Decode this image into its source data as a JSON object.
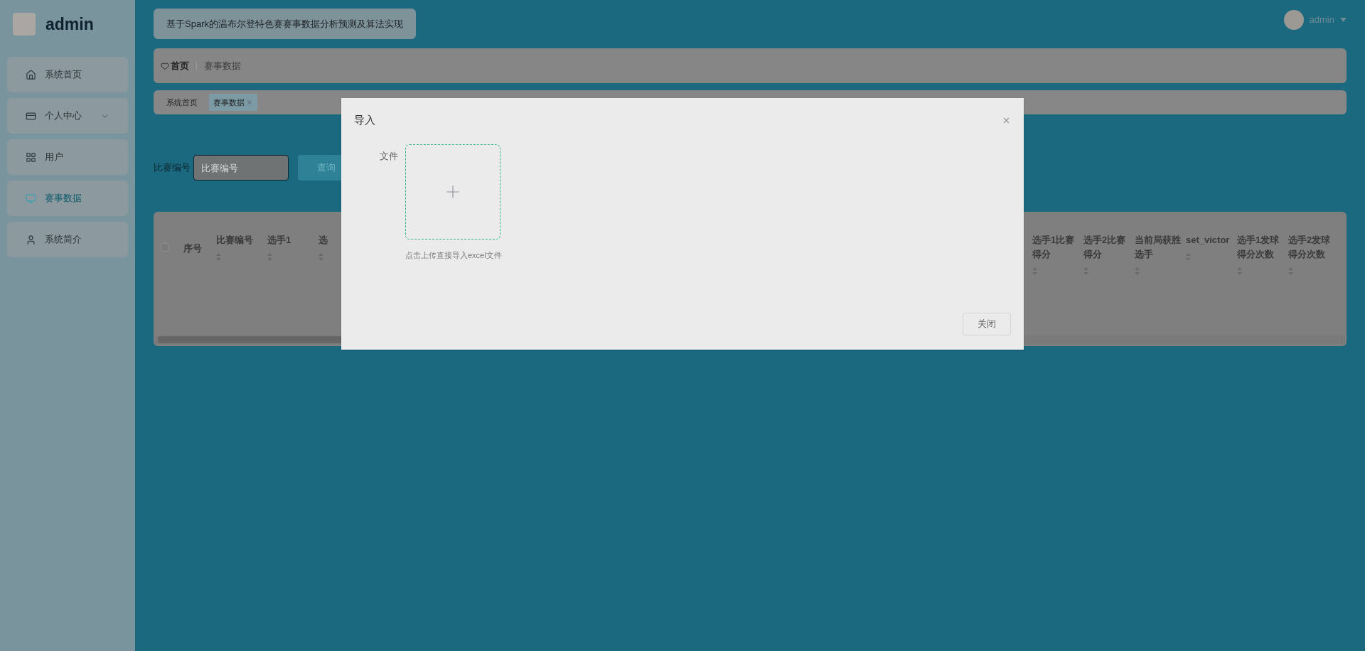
{
  "sidebar": {
    "brand": "admin",
    "items": [
      {
        "label": "系统首页",
        "selected": false,
        "expandable": false
      },
      {
        "label": "个人中心",
        "selected": false,
        "expandable": true
      },
      {
        "label": "用户",
        "selected": false,
        "expandable": false
      },
      {
        "label": "赛事数据",
        "selected": true,
        "expandable": false
      },
      {
        "label": "系统简介",
        "selected": false,
        "expandable": false
      }
    ]
  },
  "header": {
    "title": "基于Spark的温布尔登特色赛赛事数据分析预测及算法实现",
    "user": "admin"
  },
  "breadcrumb": [
    {
      "label": "首页",
      "current": false
    },
    {
      "label": "赛事数据",
      "current": true
    }
  ],
  "tabs": [
    {
      "label": "系统首页",
      "selected": false,
      "closable": false
    },
    {
      "label": "赛事数据",
      "selected": true,
      "closable": true
    }
  ],
  "search": {
    "label": "比赛编号",
    "placeholder": "比赛编号",
    "button": "查询"
  },
  "table": {
    "select_all": {
      "checked": false
    },
    "columns_left_of_dialog": [
      {
        "label": "序号",
        "sortable": false
      },
      {
        "label": "比赛编号",
        "sortable": true
      },
      {
        "label": "选手1",
        "sortable": true
      },
      {
        "label": "选",
        "sortable": true
      }
    ],
    "columns_right_of_dialog": [
      {
        "label": "选手1比赛得分",
        "sortable": true
      },
      {
        "label": "选手2比赛得分",
        "sortable": true
      },
      {
        "label": "当前局获胜选手",
        "sortable": true
      },
      {
        "label": "set_victor",
        "sortable": true
      },
      {
        "label": "选手1发球得分次数",
        "sortable": true
      },
      {
        "label": "选手2发球得分次数",
        "sortable": true
      }
    ]
  },
  "dialog": {
    "title": "导入",
    "field_label": "文件",
    "hint": "点击上传直接导入excel文件",
    "button": "关闭"
  }
}
